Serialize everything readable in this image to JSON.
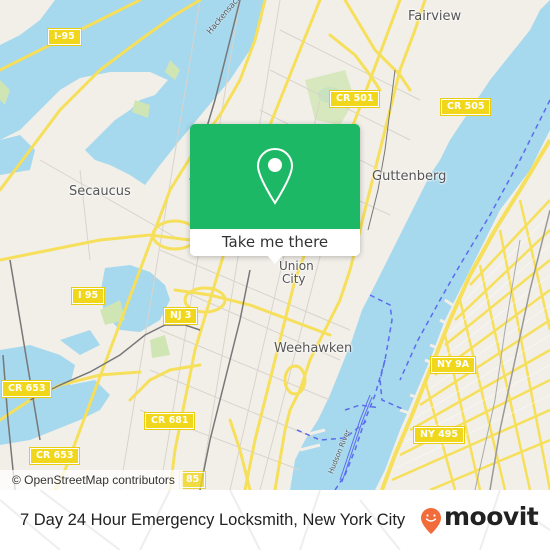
{
  "map": {
    "places": [
      {
        "id": "fairview",
        "label": "Fairview"
      },
      {
        "id": "secaucus",
        "label": "Secaucus"
      },
      {
        "id": "guttenberg",
        "label": "Guttenberg"
      },
      {
        "id": "union-city-1",
        "label": "Union"
      },
      {
        "id": "union-city-2",
        "label": "City"
      },
      {
        "id": "weehawken",
        "label": "Weehawken"
      }
    ],
    "water_labels": {
      "hackensack": "Hackensack River",
      "hudson": "Hudson River"
    },
    "shields": [
      {
        "id": "i95-top",
        "label": "I-95"
      },
      {
        "id": "cr501",
        "label": "CR 501"
      },
      {
        "id": "cr505",
        "label": "CR 505"
      },
      {
        "id": "i95-mid",
        "label": "I 95"
      },
      {
        "id": "nj3",
        "label": "NJ 3"
      },
      {
        "id": "cr653-a",
        "label": "CR 653"
      },
      {
        "id": "cr653-b",
        "label": "CR 653"
      },
      {
        "id": "cr681",
        "label": "CR 681"
      },
      {
        "id": "ny9a",
        "label": "NY 9A"
      },
      {
        "id": "ny495",
        "label": "NY 495"
      },
      {
        "id": "partial-bottom",
        "label": "85"
      }
    ],
    "attribution": "© OpenStreetMap contributors",
    "colors": {
      "land": "#f2efe9",
      "water": "#a6d8ee",
      "park": "#cfe6b4",
      "road": "#f6df5a",
      "ferry": "#5b6cf0"
    }
  },
  "popup": {
    "icon": "location-pin-icon",
    "button_label": "Take me there",
    "color": "#1db865"
  },
  "footer": {
    "title": "7 Day 24 Hour Emergency Locksmith, New York City",
    "brand": "moovit",
    "brand_color": "#f26b3a"
  }
}
